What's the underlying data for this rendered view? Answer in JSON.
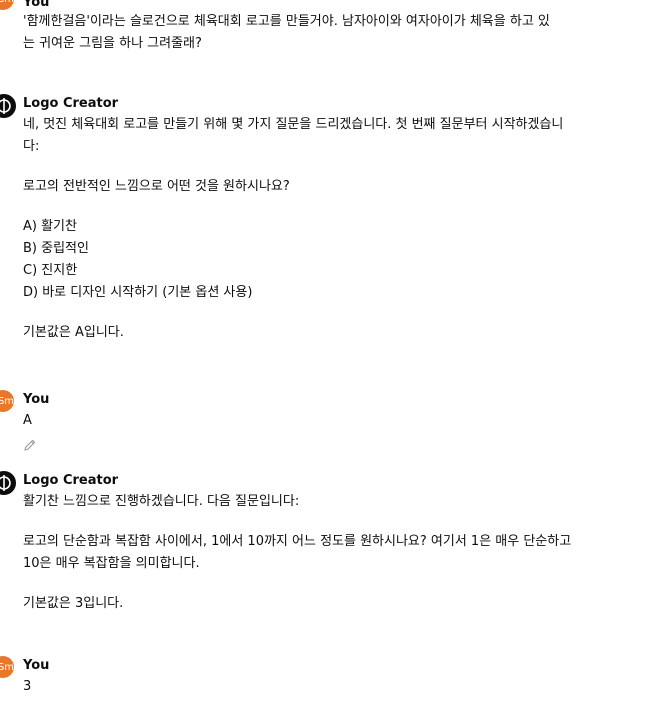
{
  "messages": {
    "m1": {
      "author": "You",
      "avatar_text": "Sm",
      "lines": [
        "'함께한걸음'이라는 슬로건으로 체육대회 로고를 만들거야. 남자아이와 여자아이가 체육을 하고 있",
        "는 귀여운 그림을 하나 그려줄래?"
      ]
    },
    "m2": {
      "author": "Logo Creator",
      "intro": [
        "네, 멋진 체육대회 로고를 만들기 위해 몇 가지 질문을 드리겠습니다. 첫 번째 질문부터 시작하겠습니",
        "다:"
      ],
      "question": "로고의 전반적인 느낌으로 어떤 것을 원하시나요?",
      "options": [
        "A) 활기찬",
        "B) 중립적인",
        "C) 진지한",
        "D) 바로 디자인 시작하기 (기본 옵션 사용)"
      ],
      "default": "기본값은 A입니다."
    },
    "m3": {
      "author": "You",
      "avatar_text": "Sm",
      "text": "A"
    },
    "m4": {
      "author": "Logo Creator",
      "intro": "활기찬 느낌으로 진행하겠습니다. 다음 질문입니다:",
      "question": [
        "로고의 단순함과 복잡함 사이에서, 1에서 10까지 어느 정도를 원하시나요? 여기서 1은 매우 단순하고",
        "10은 매우 복잡함을 의미합니다."
      ],
      "default": "기본값은 3입니다."
    },
    "m5": {
      "author": "You",
      "avatar_text": "Sm",
      "text": "3"
    }
  },
  "colors": {
    "user_avatar": "#e8772e",
    "bot_avatar": "#0d0d0d",
    "text": "#0d0d0d"
  },
  "icons": {
    "edit": "pencil-icon",
    "bot": "logo-creator-icon"
  }
}
